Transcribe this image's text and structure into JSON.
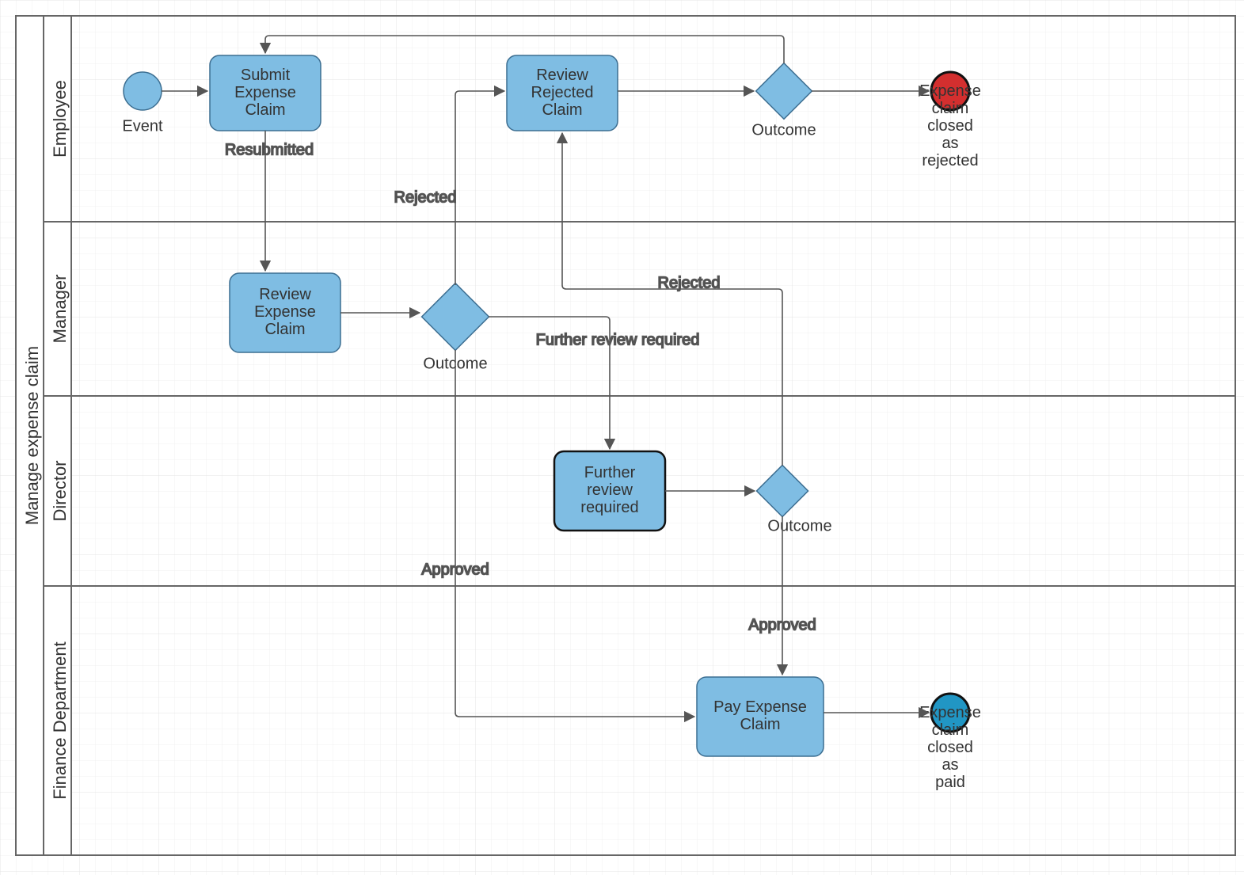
{
  "pool": {
    "title": "Manage expense claim"
  },
  "lanes": {
    "employee": "Employee",
    "manager": "Manager",
    "director": "Director",
    "finance": "Finance Department"
  },
  "events": {
    "start": "Event",
    "end_rejected": "Expense\nclaim\nclosed\nas\nrejected",
    "end_paid": "Expense\nclaim\nclosed\nas\npaid"
  },
  "tasks": {
    "submit": "Submit\nExpense\nClaim",
    "review_rejected": "Review\nRejected\nClaim",
    "review": "Review\nExpense\nClaim",
    "further_review": "Further\nreview\nrequired",
    "pay": "Pay Expense\nClaim"
  },
  "gateways": {
    "g1": "Outcome",
    "g2": "Outcome",
    "g3": "Outcome"
  },
  "edges": {
    "resubmitted": "Resubmitted",
    "rejected1": "Rejected",
    "rejected2": "Rejected",
    "further": "Further review required",
    "approved1": "Approved",
    "approved2": "Approved"
  },
  "colors": {
    "shape_fill": "#7FBDE3",
    "shape_stroke": "#3C6E91",
    "end_red": "#D32F2F",
    "end_blue": "#2196C4",
    "grid1": "#f0f0f0",
    "grid2": "#e4e4e4",
    "border": "#666"
  }
}
